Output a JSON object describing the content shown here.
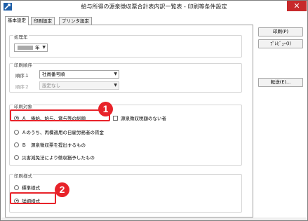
{
  "window": {
    "title": "給与所得の源泉徴収票合計表内訳一覧表 - 印刷等条件設定",
    "close_glyph": "✕"
  },
  "tabs": [
    {
      "label": "基本設定",
      "active": true
    },
    {
      "label": "印刷設定",
      "active": false
    },
    {
      "label": "プリンタ設定",
      "active": false
    }
  ],
  "processing_year": {
    "legend": "処理年",
    "year_suffix": "年"
  },
  "print_order": {
    "legend": "印刷順序",
    "order1_label": "順序１",
    "order1_value": "社員番号順",
    "order2_label": "順序２",
    "order2_value": "設定なし"
  },
  "print_target": {
    "legend": "印刷対象",
    "options": [
      {
        "label": "Ａ　俸給、給与、賞与等の総額",
        "checked": true
      },
      {
        "label": "Ａのうち、丙欄適用の日雇労務者の賃金",
        "checked": false
      },
      {
        "label": "Ｂ　源泉徴収票を提出するもの",
        "checked": false
      },
      {
        "label": "災害減免法により徴収猶予したもの",
        "checked": false
      }
    ],
    "checkbox_label": "源泉徴収税額のない者"
  },
  "print_style": {
    "legend": "印刷様式",
    "options": [
      {
        "label": "標準様式",
        "checked": false
      },
      {
        "label": "詳細様式",
        "checked": true
      }
    ]
  },
  "buttons": {
    "print": "印刷(P)",
    "preview": "ﾌﾟﾚﾋﾞｭｰ(I)",
    "transfer": "転送(E)..."
  },
  "annotations": {
    "badge1": "1",
    "badge2": "2",
    "accent_color": "#e8232a"
  }
}
